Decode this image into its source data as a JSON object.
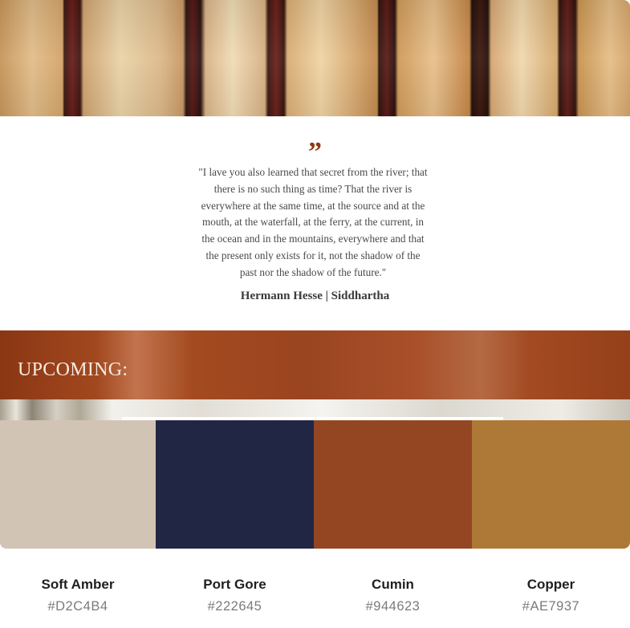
{
  "quote": {
    "mark": "”",
    "lines": [
      "\"I lave you also learned that secret from the river; that",
      "there is no such thing as time? That the river is",
      "everywhere at the same time, at the source and at the",
      "mouth, at the waterfall, at the ferry, at the current, in",
      "the ocean and in the mountains, everywhere and that",
      "the present only exists for it, not the shadow of the",
      "past nor the shadow of the future.\""
    ],
    "attribution": "Hermann Hesse | Siddhartha"
  },
  "banner": {
    "title": "UPCOMING:"
  },
  "palette": [
    {
      "name": "Soft Amber",
      "hex": "#D2C4B4",
      "color": "#D2C4B4"
    },
    {
      "name": "Port Gore",
      "hex": "#222645",
      "color": "#222645"
    },
    {
      "name": "Cumin",
      "hex": "#944623",
      "color": "#944623"
    },
    {
      "name": "Copper",
      "hex": "#AE7937",
      "color": "#AE7937"
    }
  ]
}
